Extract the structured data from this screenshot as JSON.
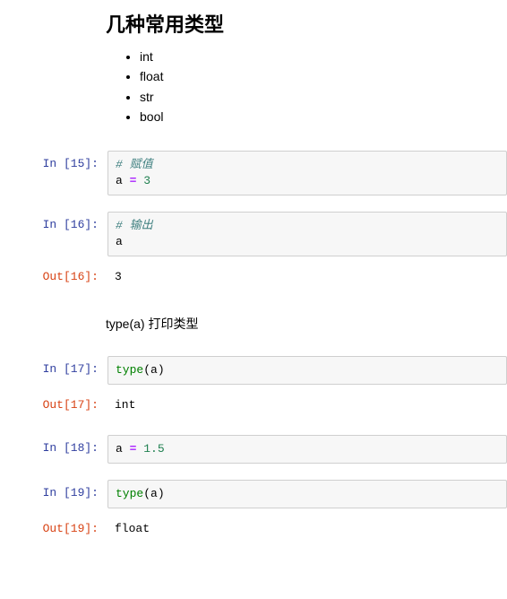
{
  "md1": {
    "heading": "几种常用类型",
    "items": [
      "int",
      "float",
      "str",
      "bool"
    ]
  },
  "cells": {
    "c15": {
      "in_label": "In  [15]:",
      "code": {
        "comment": "# 赋值",
        "line2_a": "a ",
        "line2_op": "=",
        "line2_sp": " ",
        "line2_num": "3"
      }
    },
    "c16": {
      "in_label": "In  [16]:",
      "code": {
        "comment": "# 输出",
        "line2": "a"
      },
      "out_label": "Out[16]:",
      "out": "3"
    },
    "md2": {
      "note": "type(a) 打印类型"
    },
    "c17": {
      "in_label": "In  [17]:",
      "code": {
        "fn": "type",
        "open": "(",
        "arg": "a",
        "close": ")"
      },
      "out_label": "Out[17]:",
      "out": "int"
    },
    "c18": {
      "in_label": "In  [18]:",
      "code": {
        "a": "a ",
        "op": "=",
        "sp": " ",
        "num": "1.5"
      }
    },
    "c19": {
      "in_label": "In  [19]:",
      "code": {
        "fn": "type",
        "open": "(",
        "arg": "a",
        "close": ")"
      },
      "out_label": "Out[19]:",
      "out": "float"
    }
  }
}
